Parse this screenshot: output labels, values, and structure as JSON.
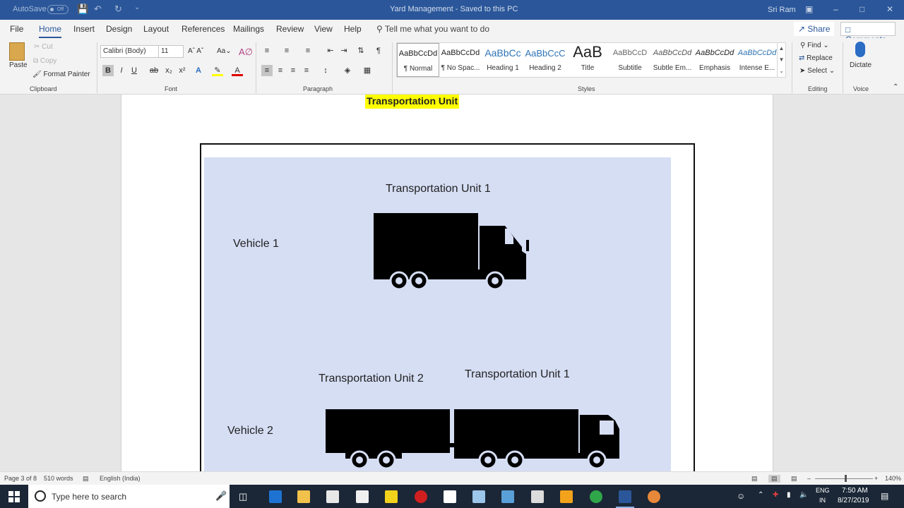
{
  "titlebar": {
    "autosave": "AutoSave",
    "autosave_state": "Off",
    "doc_title": "Yard Management  -  Saved to this PC",
    "user": "Sri Ram"
  },
  "tabs": [
    "File",
    "Home",
    "Insert",
    "Design",
    "Layout",
    "References",
    "Mailings",
    "Review",
    "View",
    "Help"
  ],
  "tell_me": "Tell me what you want to do",
  "share": "Share",
  "comments": "Comments",
  "clipboard": {
    "paste": "Paste",
    "cut": "Cut",
    "copy": "Copy",
    "format_painter": "Format Painter",
    "label": "Clipboard"
  },
  "font": {
    "name": "Calibri (Body)",
    "size": "11",
    "label": "Font"
  },
  "paragraph": {
    "label": "Paragraph"
  },
  "styles": {
    "label": "Styles",
    "items": [
      {
        "sample": "AaBbCcDd",
        "name": "¶ Normal"
      },
      {
        "sample": "AaBbCcDd",
        "name": "¶ No Spac..."
      },
      {
        "sample": "AaBbCc",
        "name": "Heading 1"
      },
      {
        "sample": "AaBbCcC",
        "name": "Heading 2"
      },
      {
        "sample": "AaB",
        "name": "Title"
      },
      {
        "sample": "AaBbCcD",
        "name": "Subtitle"
      },
      {
        "sample": "AaBbCcDd",
        "name": "Subtle Em..."
      },
      {
        "sample": "AaBbCcDd",
        "name": "Emphasis"
      },
      {
        "sample": "AaBbCcDd",
        "name": "Intense E..."
      }
    ]
  },
  "editing": {
    "find": "Find",
    "replace": "Replace",
    "select": "Select",
    "label": "Editing"
  },
  "voice": {
    "dictate": "Dictate",
    "label": "Voice"
  },
  "document": {
    "heading": "Transportation Unit",
    "diagram": {
      "top_unit": "Transportation Unit 1",
      "vehicle1": "Vehicle 1",
      "unit2": "Transportation Unit 2",
      "unit1b": "Transportation Unit 1",
      "vehicle2": "Vehicle 2"
    }
  },
  "status": {
    "page": "Page 3 of 8",
    "words": "510 words",
    "language": "English (India)",
    "zoom": "140%"
  },
  "taskbar": {
    "search": "Type here to search",
    "lang1": "ENG",
    "lang2": "IN",
    "time": "7:50 AM",
    "date": "8/27/2019"
  }
}
